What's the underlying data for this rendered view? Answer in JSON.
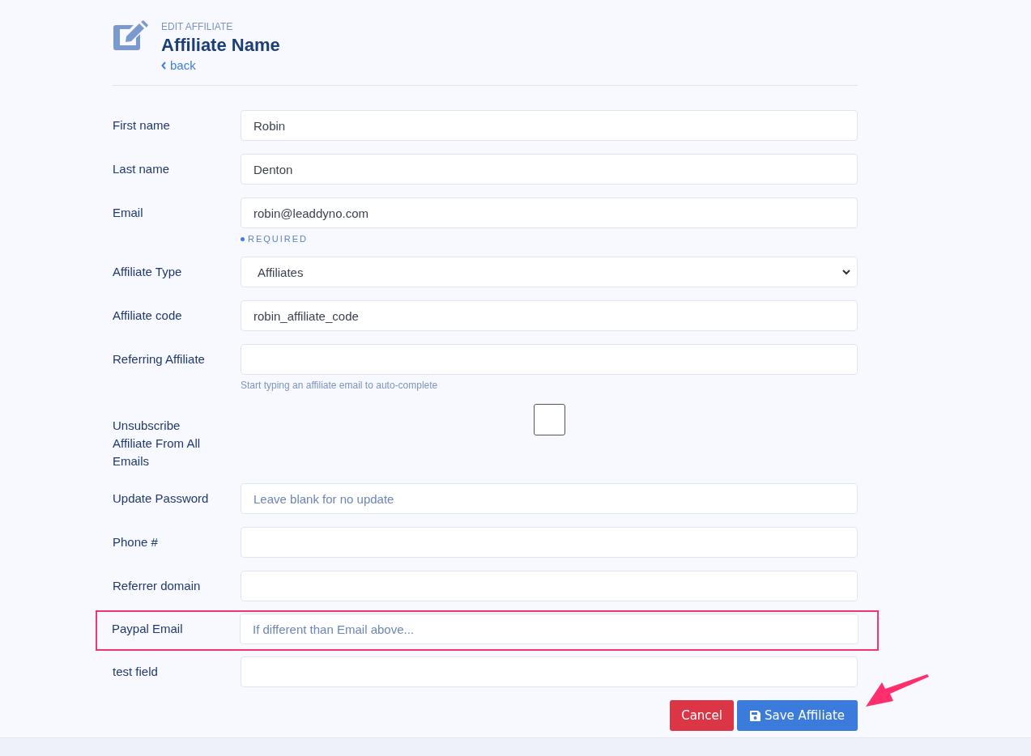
{
  "header": {
    "eyebrow": "EDIT AFFILIATE",
    "title": "Affiliate Name",
    "back_link": "back"
  },
  "fields": [
    {
      "kind": "text",
      "label": "First name",
      "value": "Robin"
    },
    {
      "kind": "text",
      "label": "Last name",
      "value": "Denton"
    },
    {
      "kind": "text",
      "label": "Email",
      "value": "robin@leaddyno.com",
      "required_note": "REQUIRED"
    },
    {
      "kind": "select",
      "label": "Affiliate Type",
      "value": "Affiliates"
    },
    {
      "kind": "text",
      "label": "Affiliate code",
      "value": "robin_affiliate_code"
    },
    {
      "kind": "text",
      "label": "Referring Affiliate",
      "help": "Start typing an affiliate email to auto-complete"
    },
    {
      "kind": "checkbox",
      "label": "Unsubscribe Affiliate From All Emails",
      "checked": false
    },
    {
      "kind": "text",
      "label": "Update Password",
      "placeholder": "Leave blank for no update"
    },
    {
      "kind": "text",
      "label": "Phone #"
    },
    {
      "kind": "text",
      "label": "Referrer domain"
    },
    {
      "kind": "text",
      "label": "Paypal Email",
      "placeholder": "If different than Email above...",
      "highlighted": true
    },
    {
      "kind": "text",
      "label": "test field"
    }
  ],
  "buttons": [
    {
      "kind": "cancel",
      "label": "Cancel"
    },
    {
      "kind": "save",
      "label": "Save Affiliate"
    }
  ]
}
